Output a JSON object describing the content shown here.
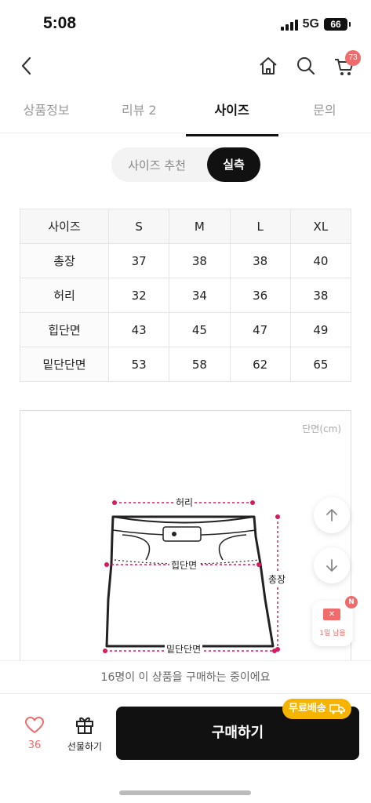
{
  "status_bar": {
    "time": "5:08",
    "network": "5G",
    "battery": "66"
  },
  "header": {
    "cart_count": "73"
  },
  "tabs": [
    {
      "label": "상품정보",
      "active": false
    },
    {
      "label": "리뷰 2",
      "active": false
    },
    {
      "label": "사이즈",
      "active": true
    },
    {
      "label": "문의",
      "active": false
    }
  ],
  "size_toggle": {
    "recommend_label": "사이즈 추천",
    "actual_label": "실측"
  },
  "size_table": {
    "headers": [
      "사이즈",
      "S",
      "M",
      "L",
      "XL"
    ],
    "rows": [
      {
        "label": "총장",
        "values": [
          "37",
          "38",
          "38",
          "40"
        ]
      },
      {
        "label": "허리",
        "values": [
          "32",
          "34",
          "36",
          "38"
        ]
      },
      {
        "label": "힙단면",
        "values": [
          "43",
          "45",
          "47",
          "49"
        ]
      },
      {
        "label": "밑단단면",
        "values": [
          "53",
          "58",
          "62",
          "65"
        ]
      }
    ]
  },
  "diagram": {
    "unit": "단면(cm)",
    "waist": "허리",
    "hip": "힙단면",
    "hem": "밑단단면",
    "length": "총장"
  },
  "coupon": {
    "badge": "N",
    "label": "1일 남음"
  },
  "notice": "16명이 이 상품을 구매하는 중이에요",
  "bottom_bar": {
    "like_count": "36",
    "gift_label": "선물하기",
    "buy_label": "구매하기",
    "shipping_badge": "무료배송"
  },
  "colors": {
    "accent": "#f06b6b",
    "dark": "#111111",
    "ship_badge": "#f6b400",
    "dimension_line": "#d81b60"
  }
}
